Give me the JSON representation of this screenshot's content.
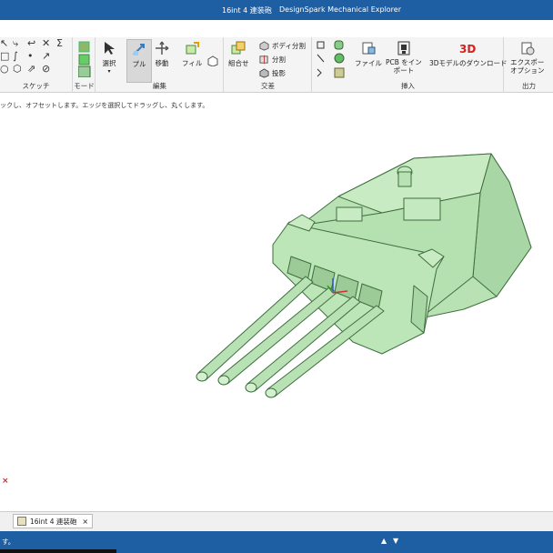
{
  "window": {
    "doc_title": "16int 4 連装砲",
    "app_title": "DesignSpark Mechanical Explorer"
  },
  "ribbon": {
    "groups": {
      "sketch": "スケッチ",
      "mode": "モード",
      "edit": "編集",
      "intersect": "交差",
      "insert": "挿入",
      "output": "出力"
    },
    "tools": {
      "select": "選択",
      "pull": "プル",
      "move": "移動",
      "fill": "フィル",
      "combine": "組合せ",
      "split_body": "ボディ分割",
      "split": "分割",
      "project": "投影",
      "file": "ファイル",
      "pcb_line1": "PCB をイン",
      "pcb_line2": "ポート",
      "model_download": "3Dモデルのダウンロード",
      "export_line1": "エクスポー",
      "export_line2": "オプション"
    }
  },
  "hint": "ックし、オフセットします。エッジを選択してドラッグし、丸くします。",
  "tab": {
    "label": "16int 4 連装砲",
    "close": "×"
  },
  "status": {
    "text": "す。",
    "arrow_up": "▲",
    "arrow_down": "▼"
  },
  "colors": {
    "title_bar": "#1e5ea3",
    "model_green": "#b8e2b4",
    "model_edge": "#3f6e3f",
    "threed_badge": "#d42020"
  }
}
